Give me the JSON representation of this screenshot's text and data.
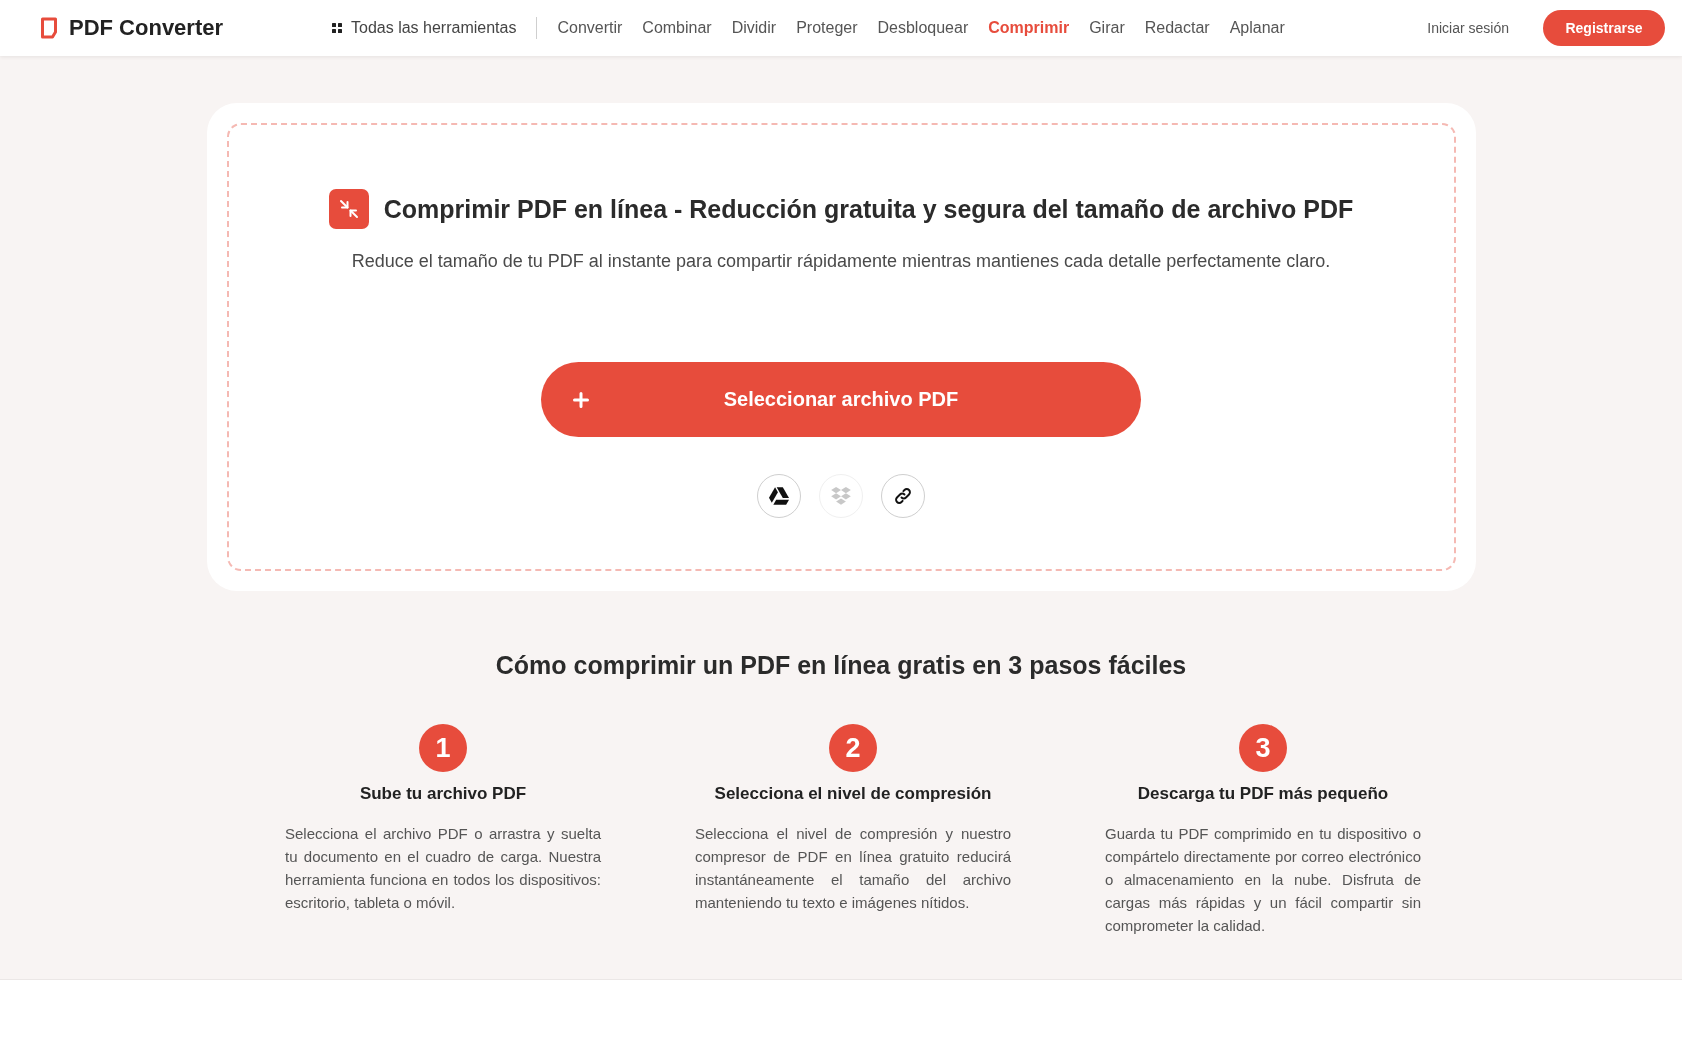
{
  "header": {
    "logo": "PDF Converter",
    "all_tools": "Todas las herramientas",
    "nav": [
      {
        "label": "Convertir",
        "selected": false
      },
      {
        "label": "Combinar",
        "selected": false
      },
      {
        "label": "Dividir",
        "selected": false
      },
      {
        "label": "Proteger",
        "selected": false
      },
      {
        "label": "Desbloquear",
        "selected": false
      },
      {
        "label": "Comprimir",
        "selected": true
      },
      {
        "label": "Girar",
        "selected": false
      },
      {
        "label": "Redactar",
        "selected": false
      },
      {
        "label": "Aplanar",
        "selected": false
      }
    ],
    "login": "Iniciar sesión",
    "signup": "Registrarse"
  },
  "upload": {
    "title": "Comprimir PDF en línea - Reducción gratuita y segura del tamaño de archivo PDF",
    "subtitle": "Reduce el tamaño de tu PDF al instante para compartir rápidamente mientras mantienes cada detalle perfectamente claro.",
    "button": "Seleccionar archivo PDF",
    "sources": [
      {
        "kind": "drive",
        "disabled": false
      },
      {
        "kind": "dropbox",
        "disabled": true
      },
      {
        "kind": "link",
        "disabled": false
      }
    ]
  },
  "steps": {
    "heading": "Cómo comprimir un PDF en línea gratis en 3 pasos fáciles",
    "items": [
      {
        "number": "1",
        "title": "Sube tu archivo PDF",
        "text": "Selecciona el archivo PDF o arrastra y suelta tu documento en el cuadro de carga. Nuestra herramienta funciona en todos los dispositivos: escritorio, tableta o móvil."
      },
      {
        "number": "2",
        "title": "Selecciona el nivel de compresión",
        "text": "Selecciona el nivel de compresión y nuestro compresor de PDF en línea gratuito reducirá instantáneamente el tamaño del archivo manteniendo tu texto e imágenes nítidos."
      },
      {
        "number": "3",
        "title": "Descarga tu PDF más pequeño",
        "text": "Guarda tu PDF comprimido en tu dispositivo o compártelo directamente por correo electrónico o almacenamiento en la nube. Disfruta de cargas más rápidas y un fácil compartir sin comprometer la calidad."
      }
    ]
  }
}
